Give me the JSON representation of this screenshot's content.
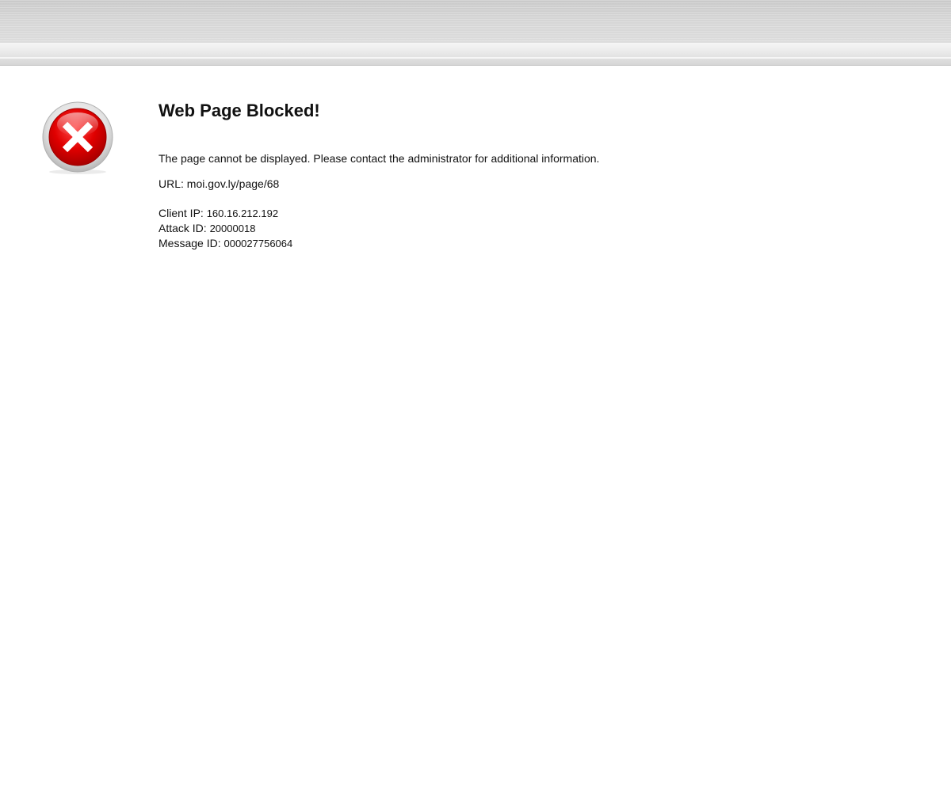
{
  "page": {
    "title": "Web Page Blocked!",
    "message": "The page cannot be displayed. Please contact the administrator for additional information.",
    "url_label": "URL:",
    "url_value": "moi.gov.ly/page/68",
    "details": [
      {
        "label": "Client IP:",
        "value": "160.16.212.192"
      },
      {
        "label": "Attack ID:",
        "value": "20000018"
      },
      {
        "label": "Message ID:",
        "value": "000027756064"
      }
    ]
  },
  "icons": {
    "blocked": "error-x-icon"
  },
  "colors": {
    "icon_red": "#e00000",
    "icon_ring": "#c9c9c9",
    "text": "#111111"
  }
}
